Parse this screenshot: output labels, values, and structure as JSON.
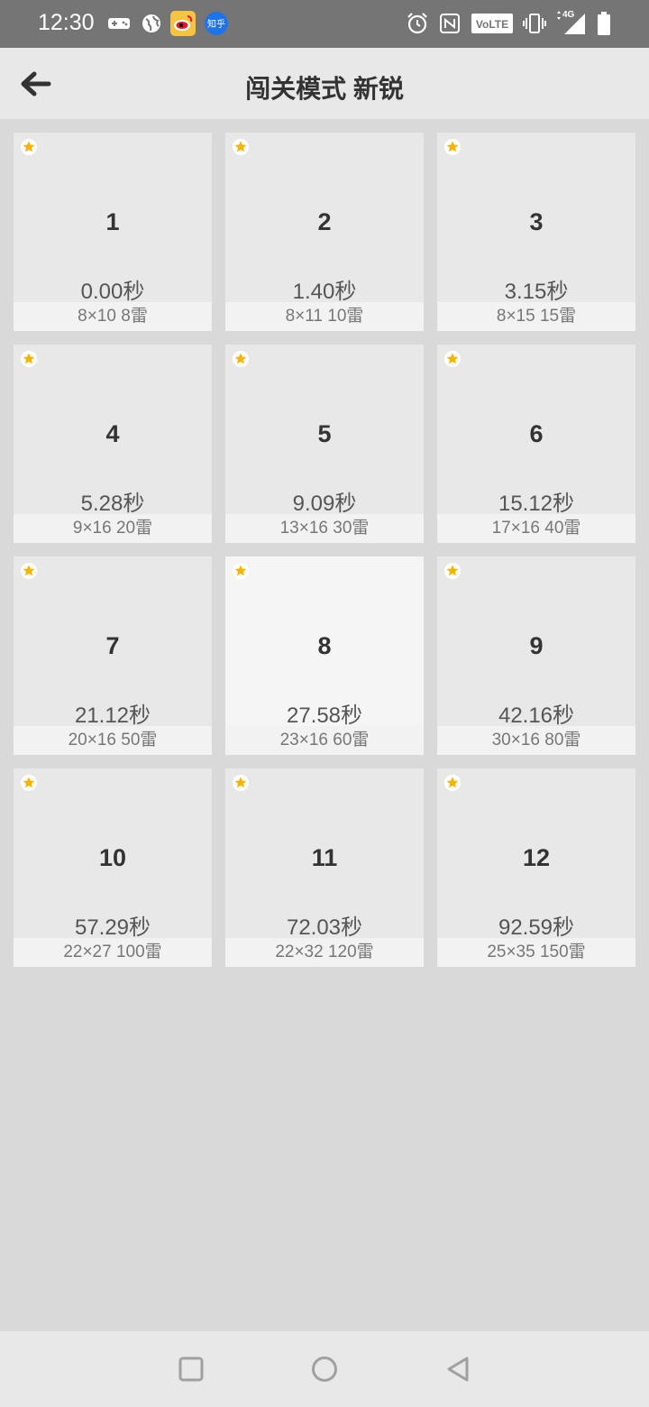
{
  "status_bar": {
    "time": "12:30",
    "left_icons": [
      "gamepad-icon",
      "globe-icon",
      "weibo-icon",
      "zhihu-icon"
    ],
    "zhihu_label": "知乎",
    "right_icons": [
      "alarm-icon",
      "nfc-icon",
      "volte-icon",
      "vibrate-icon",
      "signal-4g-icon",
      "battery-icon"
    ],
    "volte_label": "VoLTE",
    "network_label": "4G"
  },
  "app_bar": {
    "title": "闯关模式 新锐",
    "back_icon": "arrow-left-icon"
  },
  "levels": [
    {
      "number": "1",
      "time": "0.00秒",
      "info": "8×10  8雷",
      "starred": true
    },
    {
      "number": "2",
      "time": "1.40秒",
      "info": "8×11  10雷",
      "starred": true
    },
    {
      "number": "3",
      "time": "3.15秒",
      "info": "8×15  15雷",
      "starred": true
    },
    {
      "number": "4",
      "time": "5.28秒",
      "info": "9×16  20雷",
      "starred": true
    },
    {
      "number": "5",
      "time": "9.09秒",
      "info": "13×16  30雷",
      "starred": true
    },
    {
      "number": "6",
      "time": "15.12秒",
      "info": "17×16  40雷",
      "starred": true
    },
    {
      "number": "7",
      "time": "21.12秒",
      "info": "20×16  50雷",
      "starred": true
    },
    {
      "number": "8",
      "time": "27.58秒",
      "info": "23×16  60雷",
      "starred": true,
      "selected": true
    },
    {
      "number": "9",
      "time": "42.16秒",
      "info": "30×16  80雷",
      "starred": true
    },
    {
      "number": "10",
      "time": "57.29秒",
      "info": "22×27  100雷",
      "starred": true
    },
    {
      "number": "11",
      "time": "72.03秒",
      "info": "22×32  120雷",
      "starred": true
    },
    {
      "number": "12",
      "time": "92.59秒",
      "info": "25×35  150雷",
      "starred": true
    }
  ],
  "nav_bar": {
    "icons": [
      "recents-square-icon",
      "home-circle-icon",
      "back-triangle-icon"
    ]
  },
  "colors": {
    "star": "#f5b400",
    "background": "#d9d9d9",
    "card": "#e8e8e8",
    "card_selected": "#f5f5f5"
  }
}
